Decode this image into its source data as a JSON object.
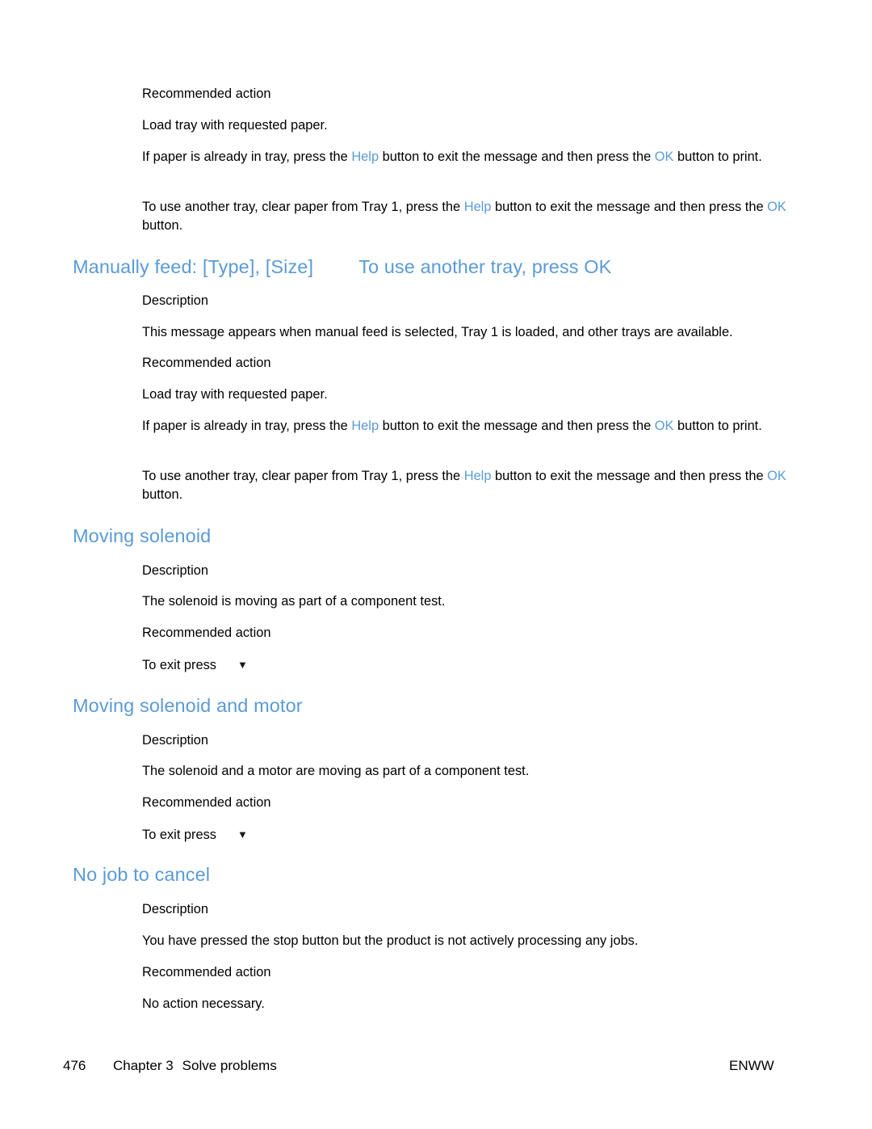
{
  "page": {
    "number": "476",
    "chapter": "Chapter 3",
    "chapter_title": "Solve problems",
    "locale_code": "ENWW",
    "accent_color": "#5b9bd5",
    "text_color": "#000000"
  },
  "labels": {
    "description": "Description",
    "recommended_action": "Recommended action",
    "down_arrow_glyph": "▼"
  },
  "ui_terms": {
    "help": "Help",
    "ok": "OK"
  },
  "sections": [
    {
      "id": "continued-top",
      "heading": "",
      "recommended_action_label": "Recommended action",
      "action_line_1": "Load tray with requested paper.",
      "action_line_2_a": "If paper is already in tray, press the ",
      "action_line_2_help": "Help",
      "action_line_2_b": " button to exit the message and then press the ",
      "action_line_2_ok": "OK",
      "action_line_2_c": " button to print.",
      "action_line_3_a": "To use another tray, clear paper from Tray 1, press the ",
      "action_line_3_help": "Help",
      "action_line_3_b": " button to exit the message and then press the ",
      "action_line_3_ok": "OK",
      "action_line_3_c": " button."
    },
    {
      "id": "manually-feed",
      "heading_main": "Manually feed: [Type], [Size]",
      "heading_alt": "To use another tray, press OK",
      "description_label": "Description",
      "description_text": "This message appears when manual feed is selected, Tray 1 is loaded, and other trays are available.",
      "recommended_action_label": "Recommended action",
      "action_line_1": "Load tray with requested paper.",
      "action_line_2_a": "If paper is already in tray, press the ",
      "action_line_2_help": "Help",
      "action_line_2_b": " button to exit the message and then press the ",
      "action_line_2_ok": "OK",
      "action_line_2_c": " button to print.",
      "action_line_3_a": "To use another tray, clear paper from Tray 1, press the ",
      "action_line_3_help": "Help",
      "action_line_3_b": " button to exit the message and then press the ",
      "action_line_3_ok": "OK",
      "action_line_3_c": " button."
    },
    {
      "id": "moving-solenoid",
      "heading": "Moving solenoid",
      "description_label": "Description",
      "description_text": "The solenoid is moving as part of a component test.",
      "recommended_action_label": "Recommended action",
      "action_text": "To exit press"
    },
    {
      "id": "moving-solenoid-and-motor",
      "heading": "Moving solenoid and motor",
      "description_label": "Description",
      "description_text": "The solenoid and a motor are moving as part of a component test.",
      "recommended_action_label": "Recommended action",
      "action_text": "To exit press"
    },
    {
      "id": "no-job-to-cancel",
      "heading": "No job to cancel",
      "description_label": "Description",
      "description_text": "You have pressed the stop button but the product is not actively processing any jobs.",
      "recommended_action_label": "Recommended action",
      "action_text": "No action necessary."
    }
  ]
}
